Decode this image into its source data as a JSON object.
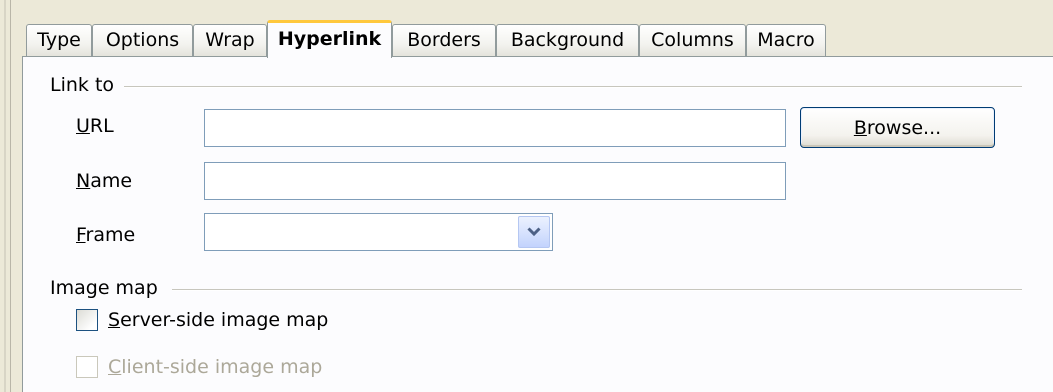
{
  "tabs": [
    {
      "label": "Type",
      "active": false
    },
    {
      "label": "Options",
      "active": false
    },
    {
      "label": "Wrap",
      "active": false
    },
    {
      "label": "Hyperlink",
      "active": true
    },
    {
      "label": "Borders",
      "active": false
    },
    {
      "label": "Background",
      "active": false
    },
    {
      "label": "Columns",
      "active": false
    },
    {
      "label": "Macro",
      "active": false
    }
  ],
  "link_to": {
    "title": "Link to",
    "url": {
      "label_access": "U",
      "label_rest": "RL",
      "value": ""
    },
    "name": {
      "label_access": "N",
      "label_rest": "ame",
      "value": ""
    },
    "frame": {
      "label_access": "F",
      "label_rest": "rame",
      "value": ""
    },
    "browse": {
      "label_access": "B",
      "label_rest": "rowse..."
    }
  },
  "image_map": {
    "title": "Image map",
    "server_side": {
      "label_access": "S",
      "label_rest": "erver-side image map",
      "checked": false,
      "enabled": true
    },
    "client_side": {
      "label_access": "C",
      "label_rest": "lient-side image map",
      "checked": false,
      "enabled": false
    }
  },
  "icons": {
    "combo_arrow": "chevron-down-icon"
  },
  "colors": {
    "active_tab_accent": "#ffc83c",
    "input_border": "#7f9db9",
    "button_border": "#003c74",
    "disabled_text": "#aca899"
  }
}
